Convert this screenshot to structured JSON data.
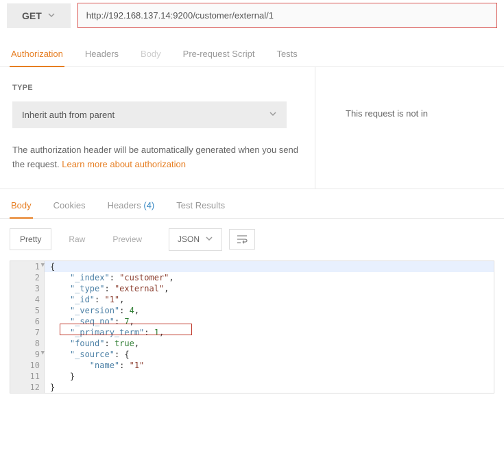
{
  "topbar": {
    "method": "GET",
    "url": "http://192.168.137.14:9200/customer/external/1"
  },
  "reqTabs": {
    "authorization": "Authorization",
    "headers": "Headers",
    "body": "Body",
    "prerequest": "Pre-request Script",
    "tests": "Tests"
  },
  "auth": {
    "typeLabel": "TYPE",
    "selected": "Inherit auth from parent",
    "descPrefix": "The authorization header will be automatically generated when you send the request. ",
    "linkText": "Learn more about authorization"
  },
  "rightInfo": "This request is not in",
  "respTabs": {
    "body": "Body",
    "cookies": "Cookies",
    "headersLabel": "Headers",
    "headersCount": "(4)",
    "testresults": "Test Results"
  },
  "controls": {
    "pretty": "Pretty",
    "raw": "Raw",
    "preview": "Preview",
    "format": "JSON"
  },
  "response": {
    "_index": "customer",
    "_type": "external",
    "_id": "1",
    "_version": 4,
    "_seq_no": 7,
    "_primary_term": 1,
    "found": true,
    "_source": {
      "name": "1"
    }
  },
  "codeLines": [
    {
      "n": 1,
      "fold": true,
      "hl": true,
      "tokens": [
        {
          "t": "punc",
          "v": "{"
        }
      ]
    },
    {
      "n": 2,
      "tokens": [
        {
          "t": "ind",
          "v": "    "
        },
        {
          "t": "key",
          "v": "\"_index\""
        },
        {
          "t": "punc",
          "v": ": "
        },
        {
          "t": "str",
          "v": "\"customer\""
        },
        {
          "t": "punc",
          "v": ","
        }
      ]
    },
    {
      "n": 3,
      "tokens": [
        {
          "t": "ind",
          "v": "    "
        },
        {
          "t": "key",
          "v": "\"_type\""
        },
        {
          "t": "punc",
          "v": ": "
        },
        {
          "t": "str",
          "v": "\"external\""
        },
        {
          "t": "punc",
          "v": ","
        }
      ]
    },
    {
      "n": 4,
      "tokens": [
        {
          "t": "ind",
          "v": "    "
        },
        {
          "t": "key",
          "v": "\"_id\""
        },
        {
          "t": "punc",
          "v": ": "
        },
        {
          "t": "str",
          "v": "\"1\""
        },
        {
          "t": "punc",
          "v": ","
        }
      ]
    },
    {
      "n": 5,
      "tokens": [
        {
          "t": "ind",
          "v": "    "
        },
        {
          "t": "key",
          "v": "\"_version\""
        },
        {
          "t": "punc",
          "v": ": "
        },
        {
          "t": "num",
          "v": "4"
        },
        {
          "t": "punc",
          "v": ","
        }
      ]
    },
    {
      "n": 6,
      "tokens": [
        {
          "t": "ind",
          "v": "    "
        },
        {
          "t": "key",
          "v": "\"_seq_no\""
        },
        {
          "t": "punc",
          "v": ": "
        },
        {
          "t": "num",
          "v": "7"
        },
        {
          "t": "punc",
          "v": ","
        }
      ]
    },
    {
      "n": 7,
      "tokens": [
        {
          "t": "ind",
          "v": "    "
        },
        {
          "t": "key",
          "v": "\"_primary_term\""
        },
        {
          "t": "punc",
          "v": ": "
        },
        {
          "t": "num",
          "v": "1"
        },
        {
          "t": "punc",
          "v": ","
        }
      ]
    },
    {
      "n": 8,
      "tokens": [
        {
          "t": "ind",
          "v": "    "
        },
        {
          "t": "key",
          "v": "\"found\""
        },
        {
          "t": "punc",
          "v": ": "
        },
        {
          "t": "bool",
          "v": "true"
        },
        {
          "t": "punc",
          "v": ","
        }
      ]
    },
    {
      "n": 9,
      "fold": true,
      "tokens": [
        {
          "t": "ind",
          "v": "    "
        },
        {
          "t": "key",
          "v": "\"_source\""
        },
        {
          "t": "punc",
          "v": ": {"
        }
      ]
    },
    {
      "n": 10,
      "tokens": [
        {
          "t": "ind",
          "v": "        "
        },
        {
          "t": "key",
          "v": "\"name\""
        },
        {
          "t": "punc",
          "v": ": "
        },
        {
          "t": "str",
          "v": "\"1\""
        }
      ]
    },
    {
      "n": 11,
      "tokens": [
        {
          "t": "ind",
          "v": "    "
        },
        {
          "t": "punc",
          "v": "}"
        }
      ]
    },
    {
      "n": 12,
      "tokens": [
        {
          "t": "punc",
          "v": "}"
        }
      ]
    }
  ]
}
